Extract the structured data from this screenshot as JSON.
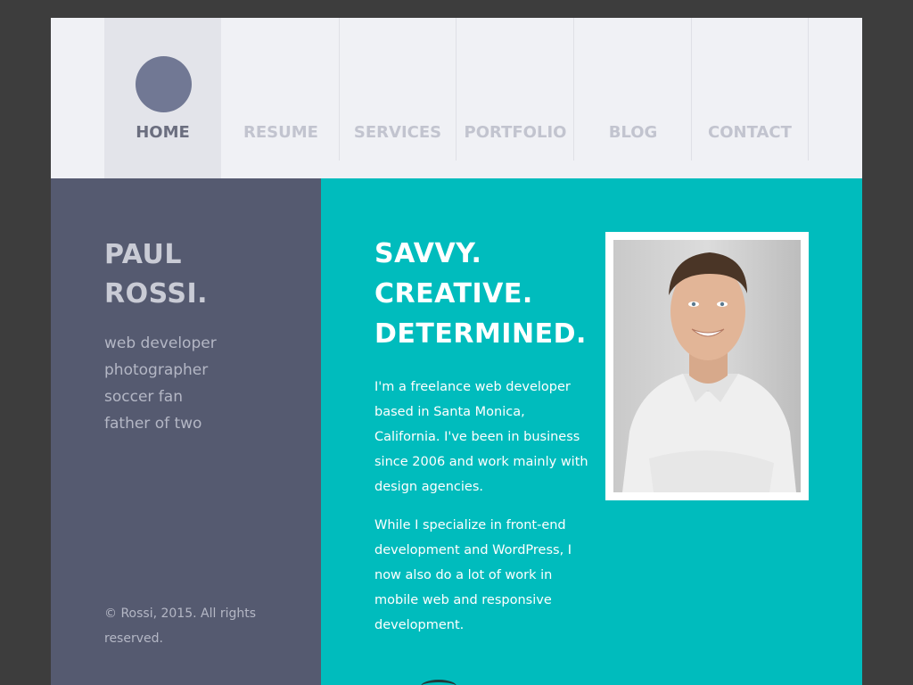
{
  "nav": {
    "items": [
      {
        "label": "HOME",
        "active": true
      },
      {
        "label": "RESUME",
        "active": false
      },
      {
        "label": "SERVICES",
        "active": false
      },
      {
        "label": "PORTFOLIO",
        "active": false
      },
      {
        "label": "BLOG",
        "active": false
      },
      {
        "label": "CONTACT",
        "active": false
      }
    ]
  },
  "sidebar": {
    "name_line1": "PAUL",
    "name_line2": "ROSSI.",
    "roles": [
      "web developer",
      "photographer",
      "soccer fan",
      "father of two"
    ],
    "copyright": "© Rossi, 2015. All rights reserved."
  },
  "main": {
    "headline": [
      "SAVVY.",
      "CREATIVE.",
      "DETERMINED."
    ],
    "paragraph1": "I'm a freelance web developer based in Santa Monica, California. I've been in business since 2006 and work mainly with design agencies.",
    "paragraph2": "While I specialize in front-end development and WordPress, I now also do a lot of work in mobile web and responsive development."
  },
  "colors": {
    "background": "#3d3d3d",
    "sidebar": "#555a70",
    "accent": "#00bcbd",
    "nav_bg": "#f0f1f5",
    "nav_active_dot": "#717894"
  }
}
